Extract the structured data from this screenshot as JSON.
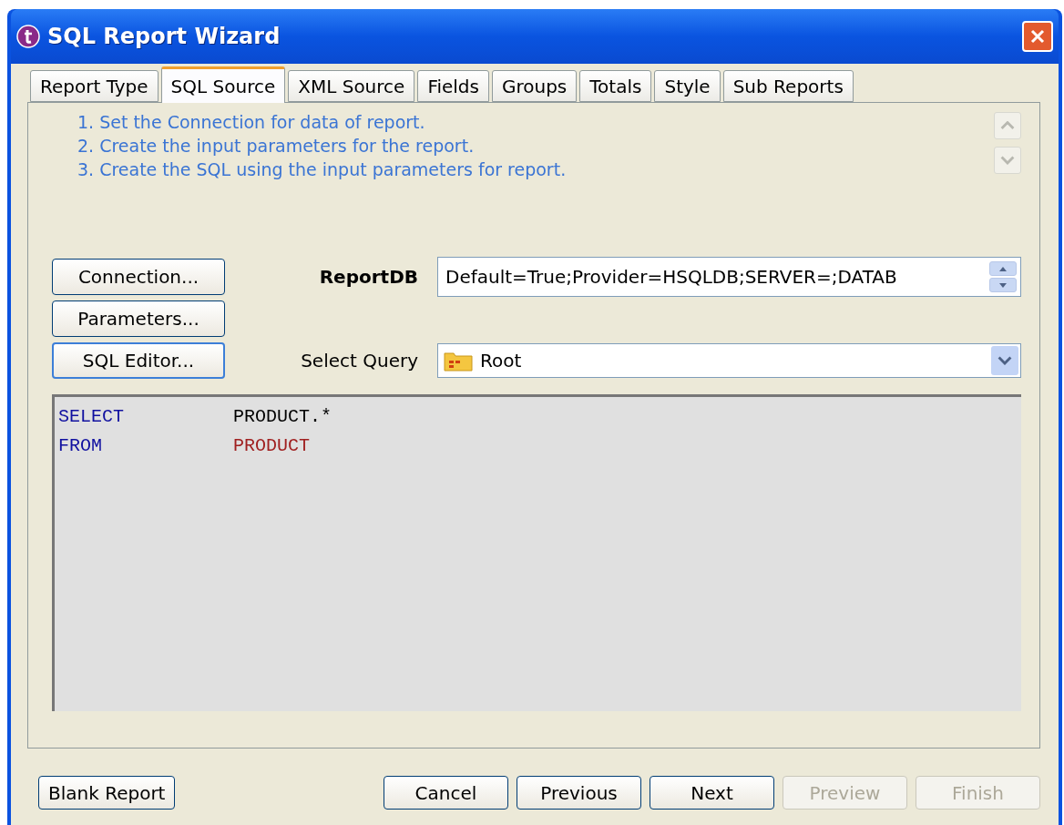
{
  "window": {
    "title": "SQL Report Wizard"
  },
  "tabs": [
    {
      "label": "Report Type",
      "selected": false
    },
    {
      "label": "SQL Source",
      "selected": true
    },
    {
      "label": "XML Source",
      "selected": false
    },
    {
      "label": "Fields",
      "selected": false
    },
    {
      "label": "Groups",
      "selected": false
    },
    {
      "label": "Totals",
      "selected": false
    },
    {
      "label": "Style",
      "selected": false
    },
    {
      "label": "Sub Reports",
      "selected": false
    }
  ],
  "instructions": [
    "1. Set the Connection for data of report.",
    "2. Create the input parameters for the report.",
    "3. Create the SQL using the input parameters for report."
  ],
  "side_buttons": [
    "Connection...",
    "Parameters...",
    "SQL Editor..."
  ],
  "connection": {
    "label": "ReportDB",
    "value": "Default=True;Provider=HSQLDB;SERVER=;DATAB"
  },
  "query": {
    "label": "Select Query",
    "value": "Root"
  },
  "sql_lines": [
    {
      "tokens": [
        {
          "text": "SELECT",
          "kind": "keyword"
        },
        {
          "text": "PRODUCT.*",
          "kind": "plain"
        }
      ]
    },
    {
      "tokens": [
        {
          "text": "FROM",
          "kind": "keyword"
        },
        {
          "text": "PRODUCT",
          "kind": "table"
        }
      ]
    }
  ],
  "footer": {
    "left_button": {
      "label": "Blank Report",
      "disabled": false
    },
    "buttons": [
      {
        "label": "Cancel",
        "disabled": false
      },
      {
        "label": "Previous",
        "disabled": false
      },
      {
        "label": "Next",
        "disabled": false
      },
      {
        "label": "Preview",
        "disabled": true
      },
      {
        "label": "Finish",
        "disabled": true
      }
    ]
  }
}
